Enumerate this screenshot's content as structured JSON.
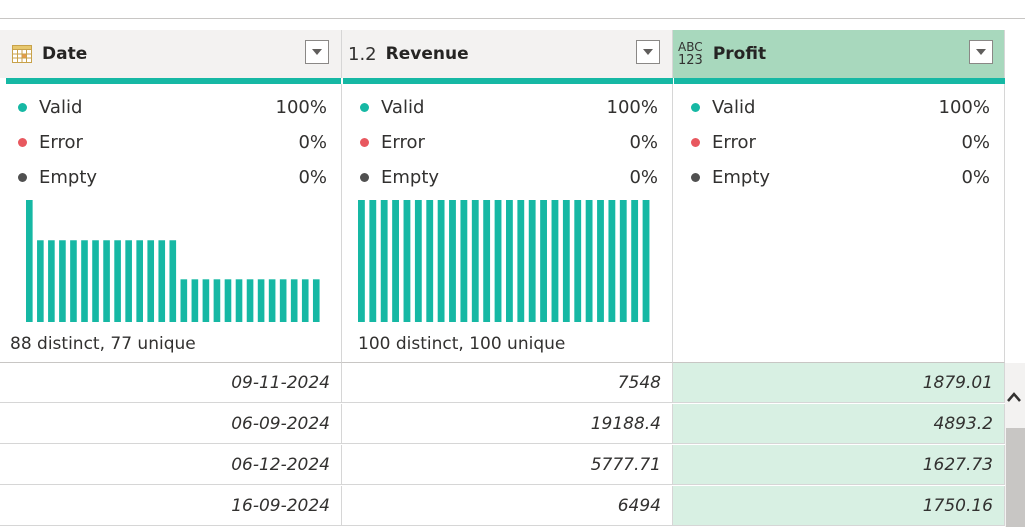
{
  "columns": [
    {
      "name": "Date",
      "type_icon": "calendar-table-icon",
      "quality": {
        "valid_label": "Valid",
        "valid": "100%",
        "error_label": "Error",
        "error": "0%",
        "empty_label": "Empty",
        "empty": "0%"
      },
      "distinct_text": "88 distinct, 77 unique",
      "histogram": [
        1.0,
        0.67,
        0.67,
        0.67,
        0.67,
        0.67,
        0.67,
        0.67,
        0.67,
        0.67,
        0.67,
        0.67,
        0.67,
        0.67,
        0.35,
        0.35,
        0.35,
        0.35,
        0.35,
        0.35,
        0.35,
        0.35,
        0.35,
        0.35,
        0.35,
        0.35,
        0.35
      ]
    },
    {
      "name": "Revenue",
      "type_label": "1.2",
      "type_icon": "decimal-number-icon",
      "quality": {
        "valid_label": "Valid",
        "valid": "100%",
        "error_label": "Error",
        "error": "0%",
        "empty_label": "Empty",
        "empty": "0%"
      },
      "distinct_text": "100 distinct, 100 unique",
      "histogram": [
        1,
        1,
        1,
        1,
        1,
        1,
        1,
        1,
        1,
        1,
        1,
        1,
        1,
        1,
        1,
        1,
        1,
        1,
        1,
        1,
        1,
        1,
        1,
        1,
        1,
        1
      ]
    },
    {
      "name": "Profit",
      "type_label_top": "ABC",
      "type_label_bottom": "123",
      "type_icon": "any-type-icon",
      "quality": {
        "valid_label": "Valid",
        "valid": "100%",
        "error_label": "Error",
        "error": "0%",
        "empty_label": "Empty",
        "empty": "0%"
      }
    }
  ],
  "rows": [
    {
      "date": "09-11-2024",
      "revenue": "7548",
      "profit": "1879.01"
    },
    {
      "date": "06-09-2024",
      "revenue": "19188.4",
      "profit": "4893.2"
    },
    {
      "date": "06-12-2024",
      "revenue": "5777.71",
      "profit": "1627.73"
    },
    {
      "date": "16-09-2024",
      "revenue": "6494",
      "profit": "1750.16"
    }
  ],
  "colors": {
    "valid": "#16b8a4",
    "error": "#e8585f",
    "empty": "#505050",
    "selected_header": "#a8d8bd",
    "selected_cell": "#d8f0e3"
  }
}
